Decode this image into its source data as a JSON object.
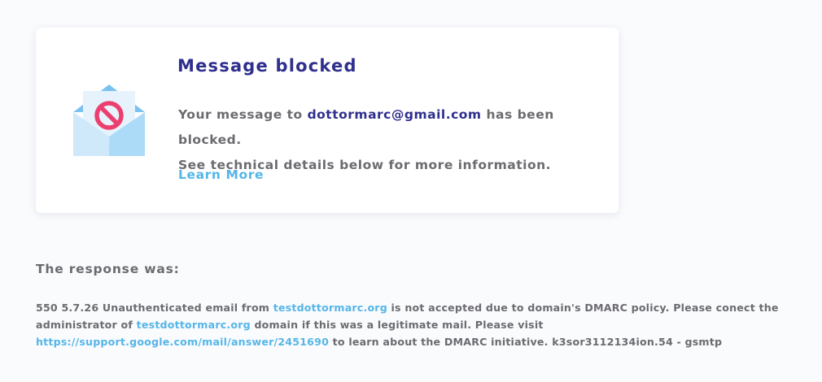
{
  "card": {
    "title": "Message blocked",
    "line1_prefix": "Your message to ",
    "recipient": "dottormarc@gmail.com",
    "line1_suffix": " has been blocked.",
    "line2": "See technical details below for more information.",
    "learn_more": "Learn More"
  },
  "response": {
    "label": "The response was:",
    "t1": "550 5.7.26 Unauthenticated email from ",
    "domain1": "testdottormarc.org",
    "t2": " is not accepted due to domain's DMARC policy. Please conect the administrator of ",
    "domain2": "testdottormarc.org",
    "t3": " domain if this was a legitimate mail. Please visit ",
    "url": "https://support.google.com/mail/answer/2451690",
    "t4": " to learn about the DMARC initiative. k3sor3112134ion.54 - gsmtp"
  },
  "colors": {
    "title": "#2f2f8f",
    "link": "#55b6e8",
    "text": "#6b6b70",
    "blocked_icon": "#ec3f6f"
  },
  "icons": {
    "envelope": "envelope-blocked-icon"
  }
}
